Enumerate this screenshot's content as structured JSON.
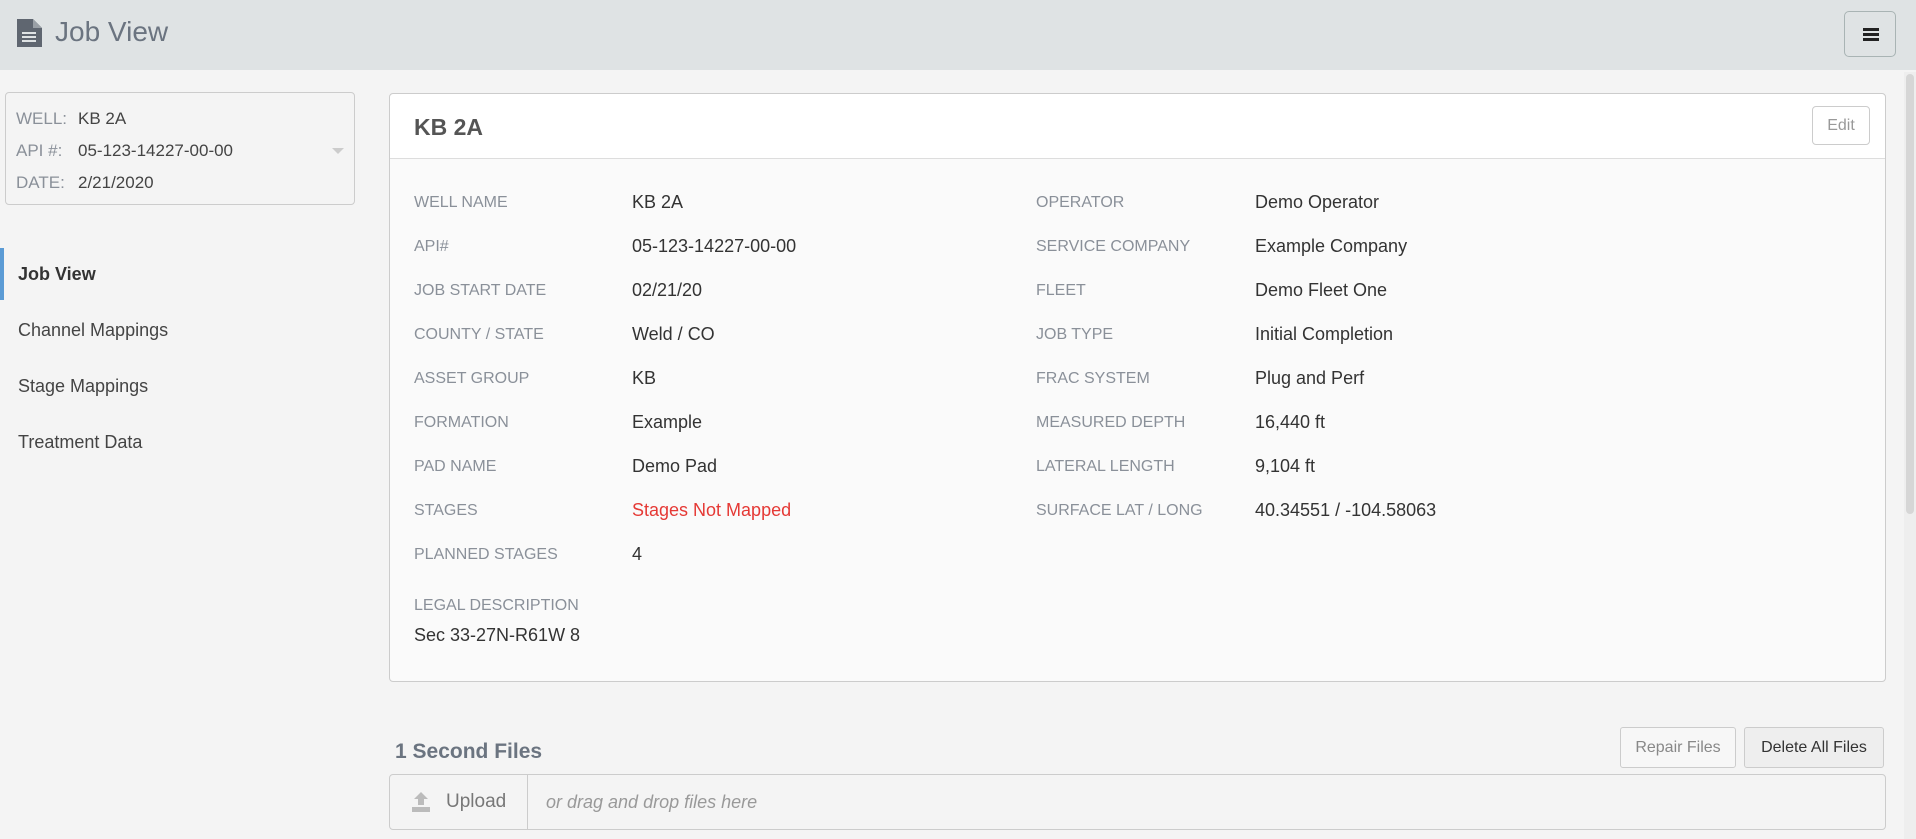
{
  "header": {
    "title": "Job View",
    "menu_icon": "hamburger-icon",
    "doc_icon": "document-icon"
  },
  "well_selector": {
    "well_label": "WELL:",
    "well": "KB 2A",
    "api_label": "API #:",
    "api": "05-123-14227-00-00",
    "date_label": "DATE:",
    "date": "2/21/2020"
  },
  "nav": [
    {
      "label": "Job View",
      "active": true
    },
    {
      "label": "Channel Mappings"
    },
    {
      "label": "Stage Mappings"
    },
    {
      "label": "Treatment Data"
    }
  ],
  "card": {
    "title": "KB 2A",
    "edit_label": "Edit",
    "left": [
      {
        "label": "WELL NAME",
        "value": "KB 2A"
      },
      {
        "label": "API#",
        "value": "05-123-14227-00-00"
      },
      {
        "label": "JOB START DATE",
        "value": "02/21/20"
      },
      {
        "label": "COUNTY / STATE",
        "value": "Weld / CO"
      },
      {
        "label": "ASSET GROUP",
        "value": "KB"
      },
      {
        "label": "FORMATION",
        "value": "Example"
      },
      {
        "label": "PAD NAME",
        "value": "Demo Pad"
      },
      {
        "label": "STAGES",
        "value": "Stages Not Mapped"
      },
      {
        "label": "PLANNED STAGES",
        "value": "4"
      }
    ],
    "right": [
      {
        "label": "OPERATOR",
        "value": "Demo Operator"
      },
      {
        "label": "SERVICE COMPANY",
        "value": "Example Company"
      },
      {
        "label": "FLEET",
        "value": "Demo Fleet One"
      },
      {
        "label": "JOB TYPE",
        "value": "Initial Completion"
      },
      {
        "label": "FRAC SYSTEM",
        "value": "Plug and Perf"
      },
      {
        "label": "MEASURED DEPTH",
        "value": "16,440 ft"
      },
      {
        "label": "LATERAL LENGTH",
        "value": "9,104 ft"
      },
      {
        "label": "SURFACE LAT / LONG",
        "value": "40.34551 / -104.58063"
      }
    ],
    "legal_label": "LEGAL DESCRIPTION",
    "legal_value": "Sec 33-27N-R61W 8"
  },
  "files": {
    "title": "1 Second Files",
    "repair_label": "Repair Files",
    "delete_label": "Delete All Files",
    "upload_label": "Upload",
    "drop_hint": "or drag and drop files here"
  },
  "colors": {
    "accent": "#5b9bd5",
    "error": "#e53935",
    "header_bg": "#dfe3e4"
  }
}
